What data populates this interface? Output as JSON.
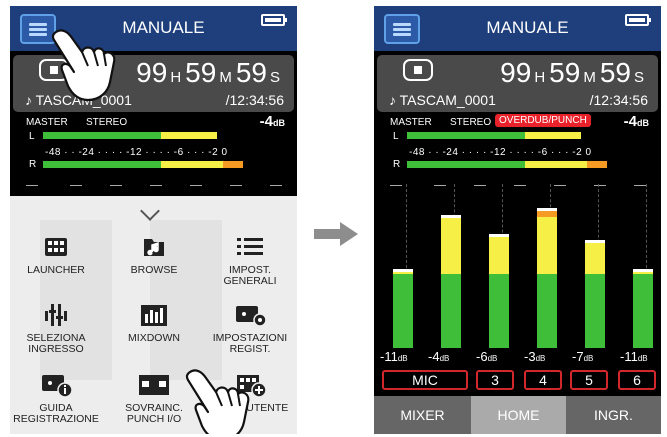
{
  "title": "MANUALE",
  "time": {
    "h": "99",
    "h_unit": "H",
    "m": "59",
    "m_unit": "M",
    "s": "59",
    "s_unit": "S"
  },
  "file_name": "♪ TASCAM_0001",
  "total_time": "/12:34:56",
  "master_label": "MASTER",
  "mode_label": "STEREO",
  "overdub_label": "OVERDUB/PUNCH",
  "master_gain": "-4",
  "gain_unit": "dB",
  "meter_labels": {
    "left": "L",
    "right": "R"
  },
  "meter_scale": "-48 · · -24 · · · · -12 · · · · -6 · · · -2 0",
  "menu_items": [
    {
      "label": "LAUNCHER",
      "icon": "grid-icon"
    },
    {
      "label": "BROWSE",
      "icon": "music-folder-icon"
    },
    {
      "label": "IMPOST. GENERALI",
      "icon": "list-icon"
    },
    {
      "label": "SELEZIONA INGRESSO",
      "icon": "input-select-icon"
    },
    {
      "label": "MIXDOWN",
      "icon": "mixdown-icon"
    },
    {
      "label": "IMPOSTAZIONI REGIST.",
      "icon": "rec-settings-icon"
    },
    {
      "label": "GUIDA REGISTRAZIONE",
      "icon": "rec-guide-icon"
    },
    {
      "label": "SOVRAINC. PUNCH I/O",
      "icon": "punch-icon"
    },
    {
      "label": "SALVA UTENTE",
      "icon": "user-save-icon"
    }
  ],
  "channels": [
    {
      "db": "-11",
      "label": "MIC",
      "level": 0.48,
      "peak": 0.5
    },
    {
      "db": "-4",
      "label": "3",
      "level": 0.82,
      "peak": 0.82
    },
    {
      "db": "-6",
      "label": "4",
      "level": 0.7,
      "peak": 0.7
    },
    {
      "db": "-3",
      "label": "5",
      "level": 0.86,
      "peak": 0.86
    },
    {
      "db": "-7",
      "label": "6",
      "level": 0.66,
      "peak": 0.66
    },
    {
      "db": "-11",
      "label": "",
      "level": 0.48,
      "peak": 0.5
    }
  ],
  "tabs": [
    {
      "label": "MIXER"
    },
    {
      "label": "HOME",
      "active": true
    },
    {
      "label": "INGR."
    }
  ],
  "colors": {
    "header": "#1e3f7c",
    "overdub": "#e8212b",
    "green": "#3fbe3a",
    "yellow": "#f6f046",
    "orange": "#f59a23"
  }
}
